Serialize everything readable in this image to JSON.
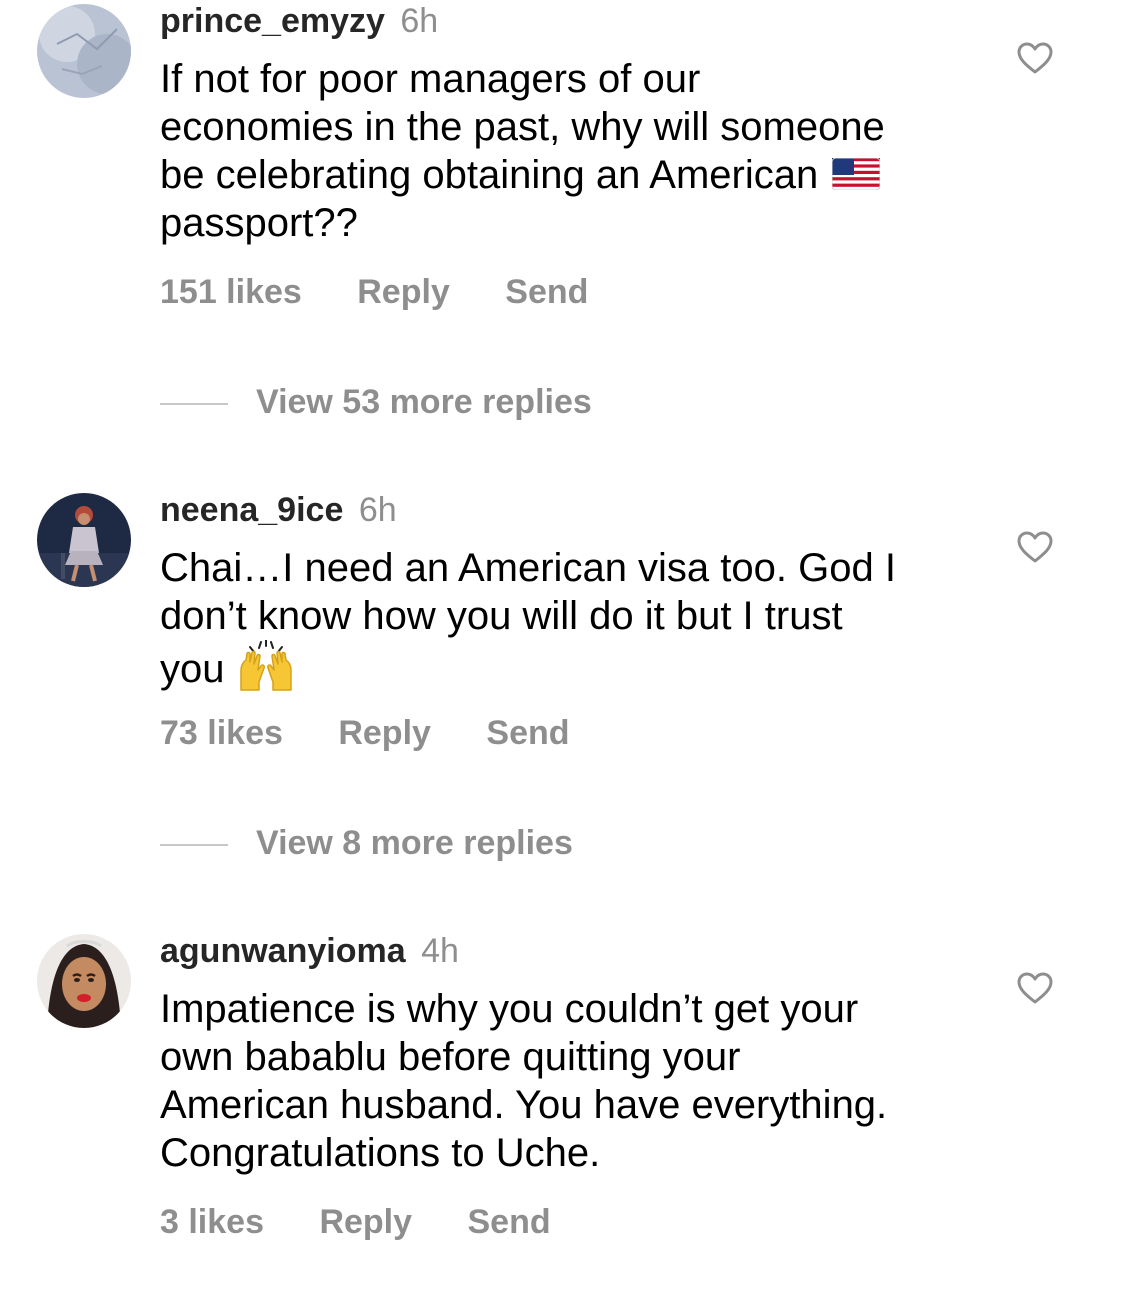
{
  "comments": [
    {
      "username": "prince_emyzy",
      "time": "6h",
      "text_lines": [
        "If not for poor managers of our",
        "economies in the past, why will someone",
        "be celebrating obtaining an American",
        "passport??"
      ],
      "emoji": "us-flag-icon",
      "likes": "151 likes",
      "reply": "Reply",
      "send": "Send",
      "view_replies": "View 53 more replies"
    },
    {
      "username": "neena_9ice",
      "time": "6h",
      "text_lines": [
        "Chai…I need an American visa too. God I",
        "don’t know how you will do it but I trust",
        "you"
      ],
      "emoji": "raising-hands-icon",
      "likes": "73 likes",
      "reply": "Reply",
      "send": "Send",
      "view_replies": "View 8 more replies"
    },
    {
      "username": "agunwanyioma",
      "time": "4h",
      "text_lines": [
        "Impatience is why you couldn’t get your",
        "own babablu before quitting your",
        "American husband. You have everything.",
        "Congratulations to Uche."
      ],
      "likes": "3 likes",
      "reply": "Reply",
      "send": "Send"
    }
  ],
  "colors": {
    "text": "#000000",
    "username": "#262626",
    "secondary": "#8e8e8e",
    "divider": "#c7c7c7"
  }
}
